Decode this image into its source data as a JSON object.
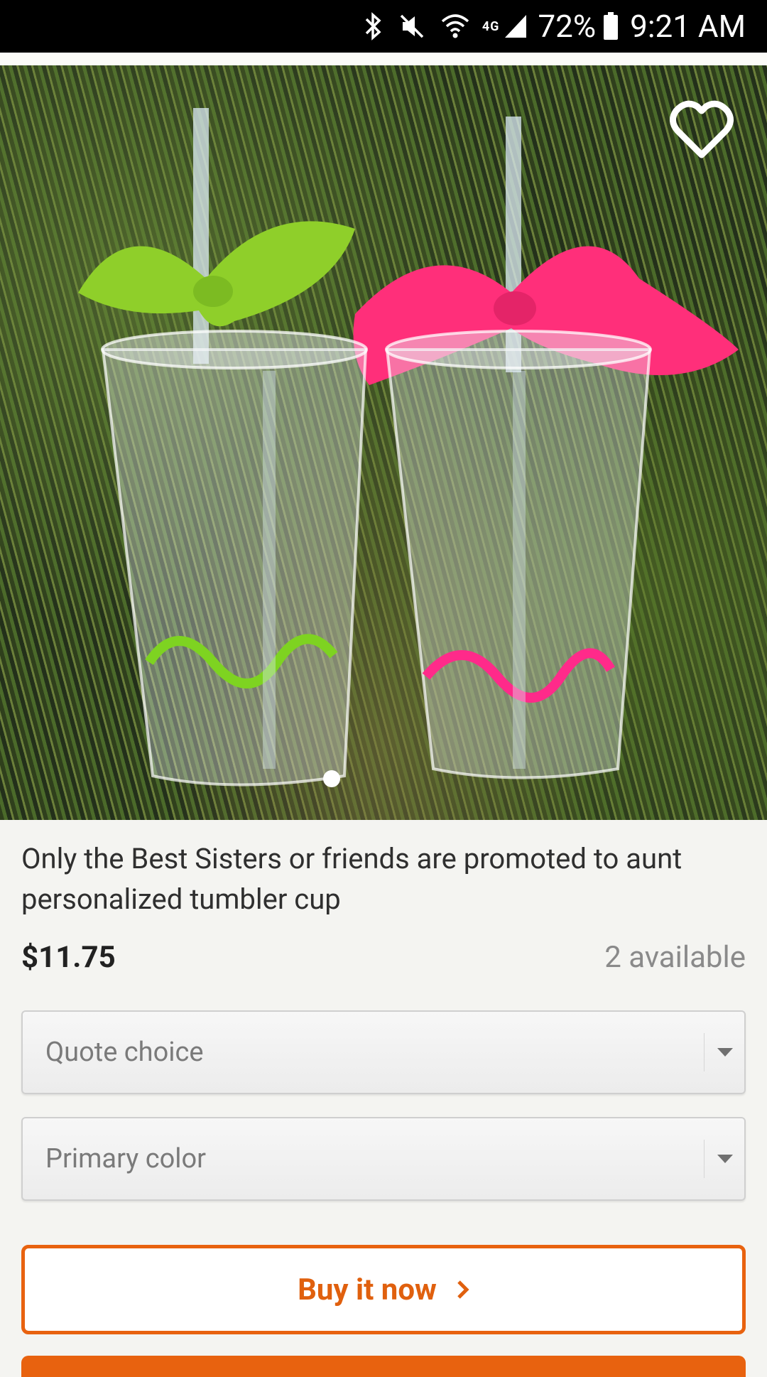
{
  "status_bar": {
    "network": "4G",
    "battery_percent": "72%",
    "time": "9:21 AM",
    "icons": [
      "bluetooth-icon",
      "mute-icon",
      "wifi-icon",
      "signal-icon",
      "battery-icon"
    ]
  },
  "product": {
    "image_alt": "two personalized tumbler cups with bows on grass",
    "favorite_icon": "heart-outline-icon",
    "carousel_total": 1,
    "carousel_active": 1,
    "title": "Only the Best Sisters or friends are promoted to aunt personalized tumbler cup",
    "price": "$11.75",
    "availability": "2 available"
  },
  "options": {
    "quote": {
      "label": "Quote choice"
    },
    "color": {
      "label": "Primary color"
    }
  },
  "actions": {
    "buy_now": "Buy it now"
  },
  "colors": {
    "accent": "#e8620f",
    "status_bar": "#000000",
    "background": "#f4f4f1"
  }
}
